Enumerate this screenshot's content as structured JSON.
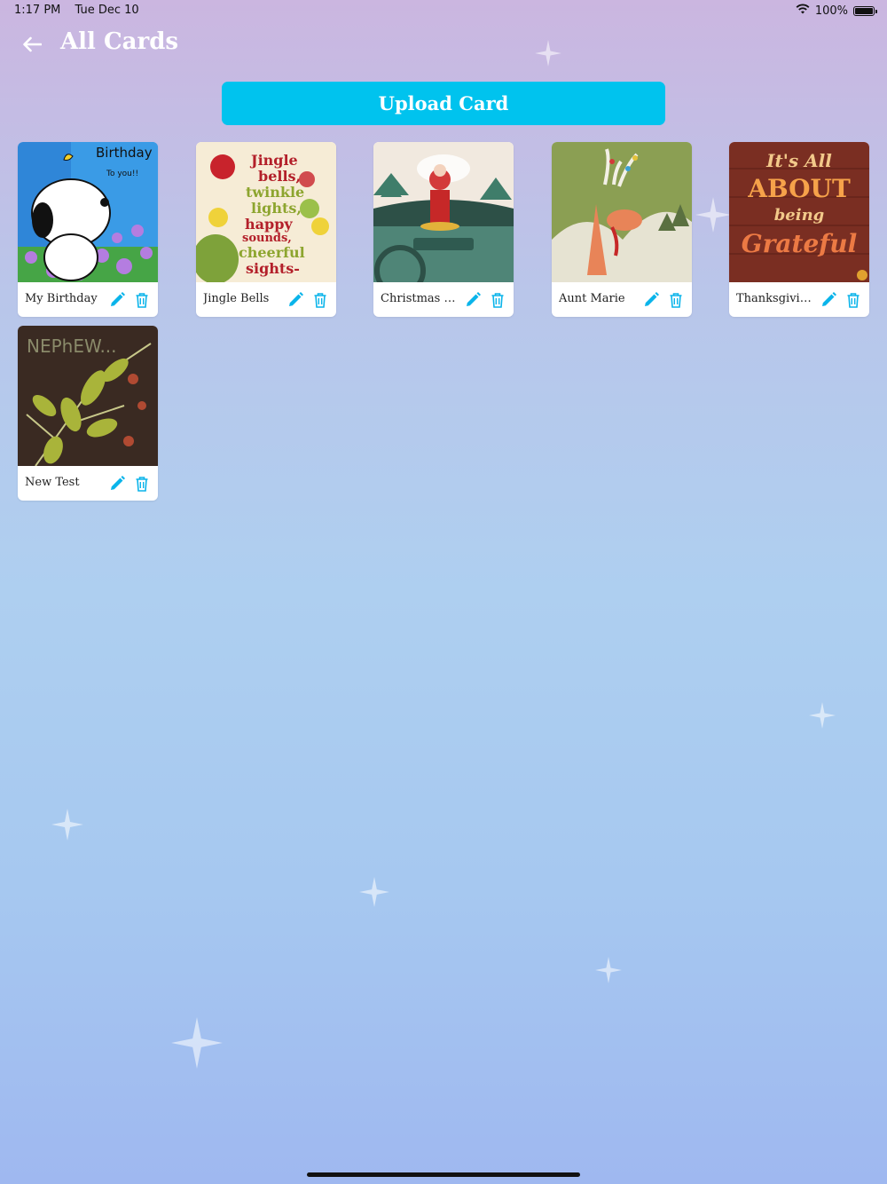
{
  "status_bar": {
    "time": "1:17 PM",
    "date": "Tue Dec 10",
    "battery": "100%",
    "battery_level": 1.0
  },
  "header": {
    "title": "All Cards",
    "back_icon": "arrow-left-icon"
  },
  "upload": {
    "label": "Upload Card"
  },
  "colors": {
    "accent": "#00c3ee",
    "icon": "#0ab4ea",
    "title": "#ffffff"
  },
  "cards": [
    {
      "name": "My Birthday",
      "thumb_lines": [
        "Birthday",
        "To you!!"
      ]
    },
    {
      "name": "Jingle Bells",
      "thumb_lines": [
        "Jingle",
        "bells,",
        "twinkle",
        "lights,",
        "happy",
        "sounds,",
        "cheerful",
        "sights-"
      ]
    },
    {
      "name": "Christmas Car",
      "thumb_lines": []
    },
    {
      "name": "Aunt Marie",
      "thumb_lines": []
    },
    {
      "name": "Thanksgiving",
      "thumb_lines": [
        "It's All",
        "ABOUT",
        "being",
        "Grateful"
      ]
    },
    {
      "name": "New Test",
      "thumb_lines": [
        "NEPhEW..."
      ]
    }
  ]
}
